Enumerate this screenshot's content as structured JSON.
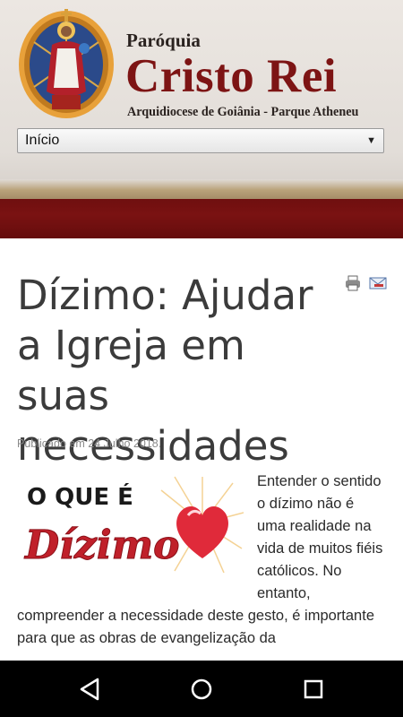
{
  "header": {
    "brand_small": "Paróquia",
    "brand_title": "Cristo Rei",
    "brand_subtitle": "Arquidiocese de Goiânia - Parque Atheneu",
    "menu_selected": "Início"
  },
  "article": {
    "title": "Dízimo: Ajudar a Igreja em suas necessidades",
    "published": "Publicado em 24 Julho 2018.",
    "graphic": {
      "line1": "O QUE É",
      "line2": "Dízimo"
    },
    "body": "Entender o sentido o dízimo não é uma realidade na vida de muitos fiéis católicos. No entanto, compreender a necessidade deste gesto, é importante para que as obras de evangelização da"
  },
  "colors": {
    "brand_red": "#7d1414",
    "band": "#6f0f0f",
    "title": "#3b3b3b"
  }
}
